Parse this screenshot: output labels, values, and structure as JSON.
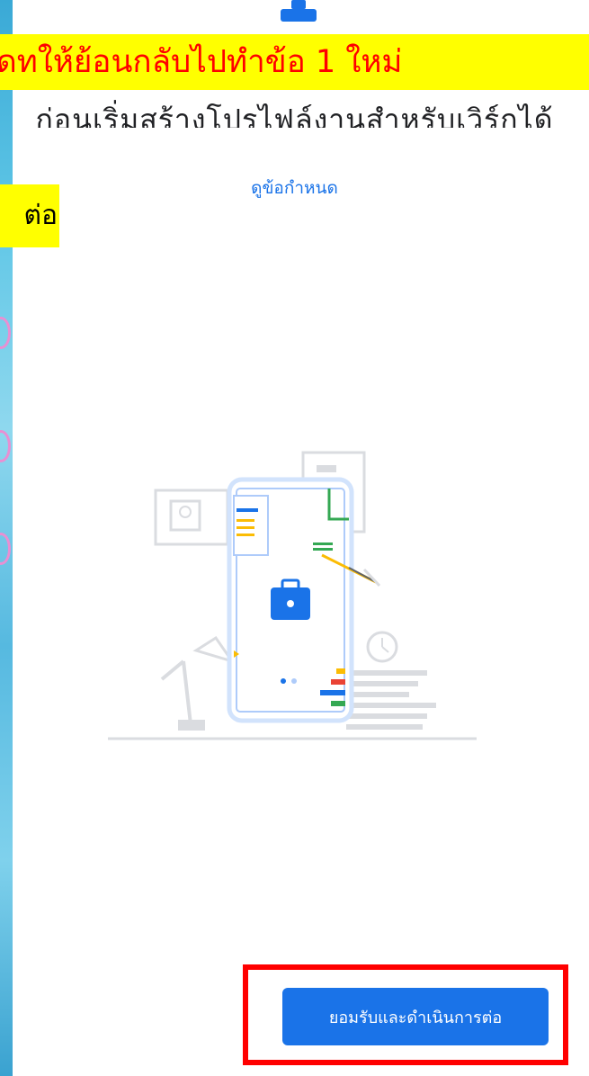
{
  "overlay": {
    "banner_text": "เดทให้ย้อนกลับไปทำข้อ 1 ใหม่",
    "side_note_text": "ต่อ"
  },
  "header": {
    "partial_title": "ก่อนเริ่มสร้างโปรไฟล์งานสำหรับเวิร์กได้"
  },
  "terms": {
    "link_label": "ดูข้อกำหนด"
  },
  "footer": {
    "accept_button_label": "ยอมรับและดำเนินการต่อ"
  },
  "icons": {
    "top": "work-briefcase-icon",
    "illustration": "work-profile-illustration"
  },
  "colors": {
    "accent": "#1a73e8",
    "banner_bg": "#ffff00",
    "banner_text": "#ff0000",
    "highlight_box": "#ff0000"
  }
}
